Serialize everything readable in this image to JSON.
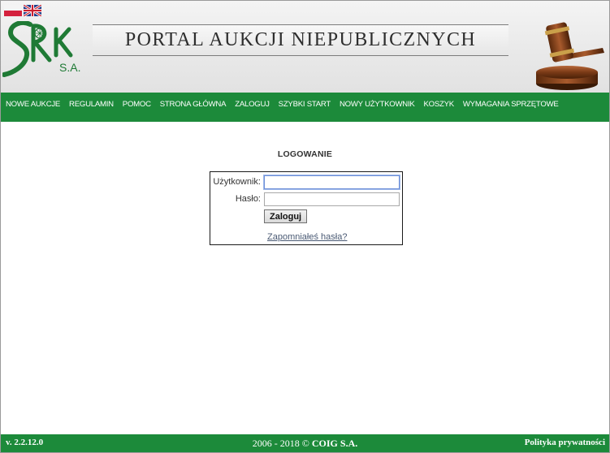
{
  "header": {
    "title": "PORTAL AUKCJI NIEPUBLICZNYCH",
    "logo_text": "SRK",
    "logo_suffix": "S.A.",
    "languages": [
      {
        "code": "pl",
        "icon": "poland-flag-icon"
      },
      {
        "code": "en",
        "icon": "uk-flag-icon"
      }
    ]
  },
  "nav": {
    "items": [
      {
        "label": "NOWE AUKCJE"
      },
      {
        "label": "REGULAMIN"
      },
      {
        "label": "POMOC"
      },
      {
        "label": "STRONA GŁÓWNA"
      },
      {
        "label": "ZALOGUJ"
      },
      {
        "label": "SZYBKI START"
      },
      {
        "label": "NOWY UŻYTKOWNIK"
      },
      {
        "label": "KOSZYK"
      },
      {
        "label": "WYMAGANIA SPRZĘTOWE"
      }
    ]
  },
  "login": {
    "heading": "LOGOWANIE",
    "user_label": "Użytkownik:",
    "user_value": "",
    "password_label": "Hasło:",
    "password_value": "",
    "submit_label": "Zaloguj",
    "forgot_label": "Zapomniałeś hasła?"
  },
  "footer": {
    "version": "v. 2.2.12.0",
    "years": "2006 - 2018",
    "copyright_symbol": "©",
    "company": "COIG S.A.",
    "privacy_label": "Polityka prywatności"
  },
  "colors": {
    "nav_green": "#1c8a3a",
    "logo_green": "#1f7a35",
    "link": "#4a5a74"
  }
}
